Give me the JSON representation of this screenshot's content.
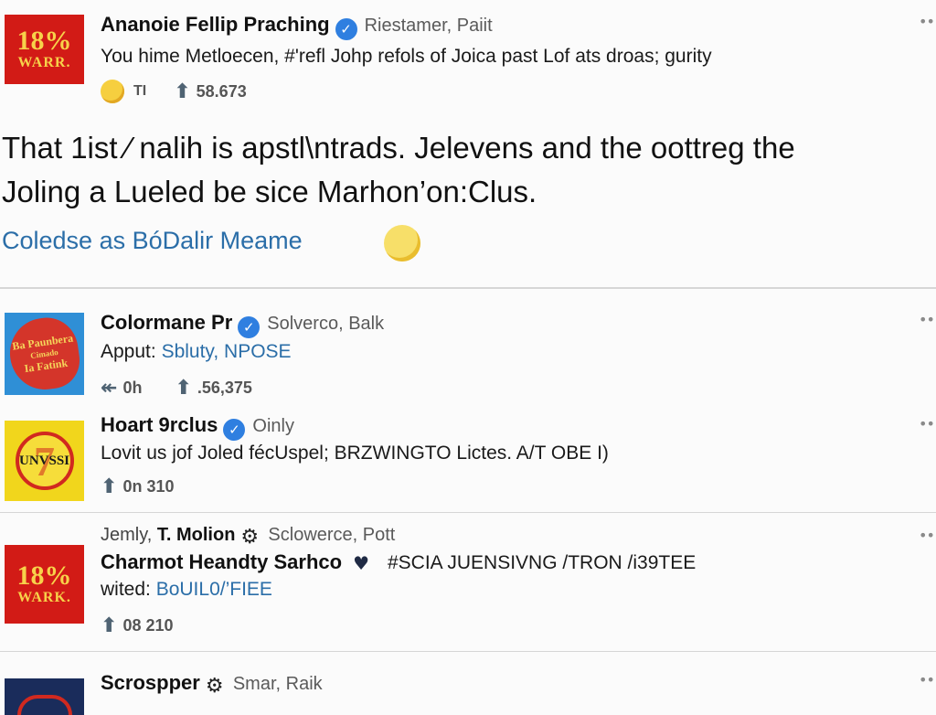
{
  "colors": {
    "accent_link": "#2b6ea8",
    "verified": "#2f7fe0",
    "divider": "#d6d6d6"
  },
  "posts": [
    {
      "logo": {
        "line1": "18%",
        "line2": "WARR."
      },
      "name": "Ananoie Fellip Praching",
      "handle": "Riestamer, Paiit",
      "subtitle": "You hime Metloecen, #'refl Johp refols of Joica past Lof ats droas; gurity",
      "reaction_label": "TI",
      "share_count": "58.673",
      "body_line1": "That 1ist ⁄ nalih is apstl\\ntrads. Jelevens and the oottreg the",
      "body_line2": "Joling a Lueled be sice Marhon’on:Clus.",
      "cta": "Coledse as BóDalir Meame"
    },
    {
      "logo": {
        "line1": "Ba Paunbera",
        "line2": "Cimado",
        "line3": "Ia Fatink"
      },
      "name": "Colormane Pr",
      "handle": "Solverco, Balk",
      "subtitle_prefix": "Apput:",
      "subtitle_link": "Sbluty, NPOSE",
      "reply_count": "0h",
      "share_count": ".56,375"
    },
    {
      "logo": {
        "text": "UNVSSI",
        "digit": "7"
      },
      "name": "Hoart 9rclus",
      "handle": "Oinly",
      "subtitle": "Lovit us jof Joled fécUspel; BRZWINGTO Lictes. A/T OBE I)",
      "count": "0n 310"
    },
    {
      "logo": {
        "line1": "18%",
        "line2": "WARK."
      },
      "kicker_prefix": "Jemly,",
      "kicker_name": "T. Molion",
      "kicker_handle": "Sclowerce, Pott",
      "name": "Charmot Heandty Sarhco",
      "hashtag": "#SCIA JUENSIVNG /TRON /i39TEE",
      "subtitle_prefix": "wited:",
      "subtitle_link": "BoUIL0/’FIEE",
      "count": "08 210"
    },
    {
      "name": "Scrospper",
      "handle": "Smar, Raik"
    }
  ],
  "icons": {
    "verified": "check",
    "badge": "gear-badge",
    "more": "dots-horizontal",
    "share": "person-arrow",
    "reply": "reply-arrow",
    "heart": "heart",
    "emoji": "smiley"
  }
}
